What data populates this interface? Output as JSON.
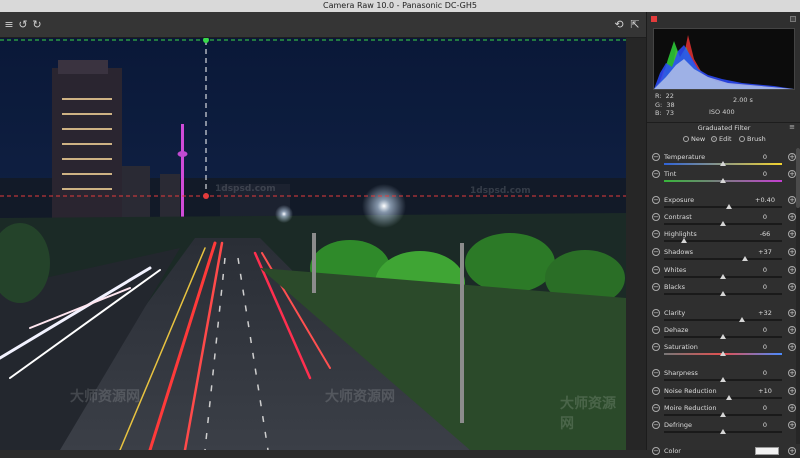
{
  "window": {
    "title": "Camera Raw 10.0  -  Panasonic DC-GH5"
  },
  "toolbar": {
    "menu_icon": "hamburger-menu-icon",
    "rotate_left_icon": "rotate-ccw-icon",
    "rotate_right_icon": "rotate-cw-icon",
    "cycle_icon": "cycle-icon",
    "export_icon": "export-icon"
  },
  "readout": {
    "r_label": "R:",
    "r_value": "22",
    "g_label": "G:",
    "g_value": "38",
    "b_label": "B:",
    "b_value": "73",
    "shutter": "2.00 s",
    "iso": "ISO 400"
  },
  "panel": {
    "title": "Graduated Filter",
    "modes": [
      {
        "label": "New",
        "selected": false
      },
      {
        "label": "Edit",
        "selected": true
      },
      {
        "label": "Brush",
        "selected": false
      }
    ],
    "sliders": [
      {
        "label": "Temperature",
        "value": "0",
        "level": 0.0,
        "min": -100,
        "max": 100
      },
      {
        "label": "Tint",
        "value": "0",
        "level": 0.0,
        "min": -100,
        "max": 100
      },
      {
        "label": "Exposure",
        "value": "+0.40",
        "level": 0.4,
        "min": -4,
        "max": 4
      },
      {
        "label": "Contrast",
        "value": "0",
        "level": 0.0,
        "min": -100,
        "max": 100
      },
      {
        "label": "Highlights",
        "value": "-66",
        "level": -66,
        "min": -100,
        "max": 100
      },
      {
        "label": "Shadows",
        "value": "+37",
        "level": 37,
        "min": -100,
        "max": 100
      },
      {
        "label": "Whites",
        "value": "0",
        "level": 0,
        "min": -100,
        "max": 100
      },
      {
        "label": "Blacks",
        "value": "0",
        "level": 0,
        "min": -100,
        "max": 100
      },
      {
        "label": "Clarity",
        "value": "+32",
        "level": 32,
        "min": -100,
        "max": 100
      },
      {
        "label": "Dehaze",
        "value": "0",
        "level": 0,
        "min": -100,
        "max": 100
      },
      {
        "label": "Saturation",
        "value": "0",
        "level": 0,
        "min": -100,
        "max": 100
      },
      {
        "label": "Sharpness",
        "value": "0",
        "level": 0,
        "min": -100,
        "max": 100
      },
      {
        "label": "Noise Reduction",
        "value": "+10",
        "level": 10,
        "min": -100,
        "max": 100
      },
      {
        "label": "Moire Reduction",
        "value": "0",
        "level": 0,
        "min": -100,
        "max": 100
      },
      {
        "label": "Defringe",
        "value": "0",
        "level": 0,
        "min": -100,
        "max": 100
      }
    ],
    "color_label": "Color"
  },
  "watermarks": [
    "1dspsd.com",
    "1dspsd.com",
    "大师资源网",
    "大师资源网",
    "大师资源网"
  ],
  "colors": {
    "accent": "#2f7bd8",
    "filter_green": "#39d94a",
    "filter_red": "#e33b3b"
  }
}
